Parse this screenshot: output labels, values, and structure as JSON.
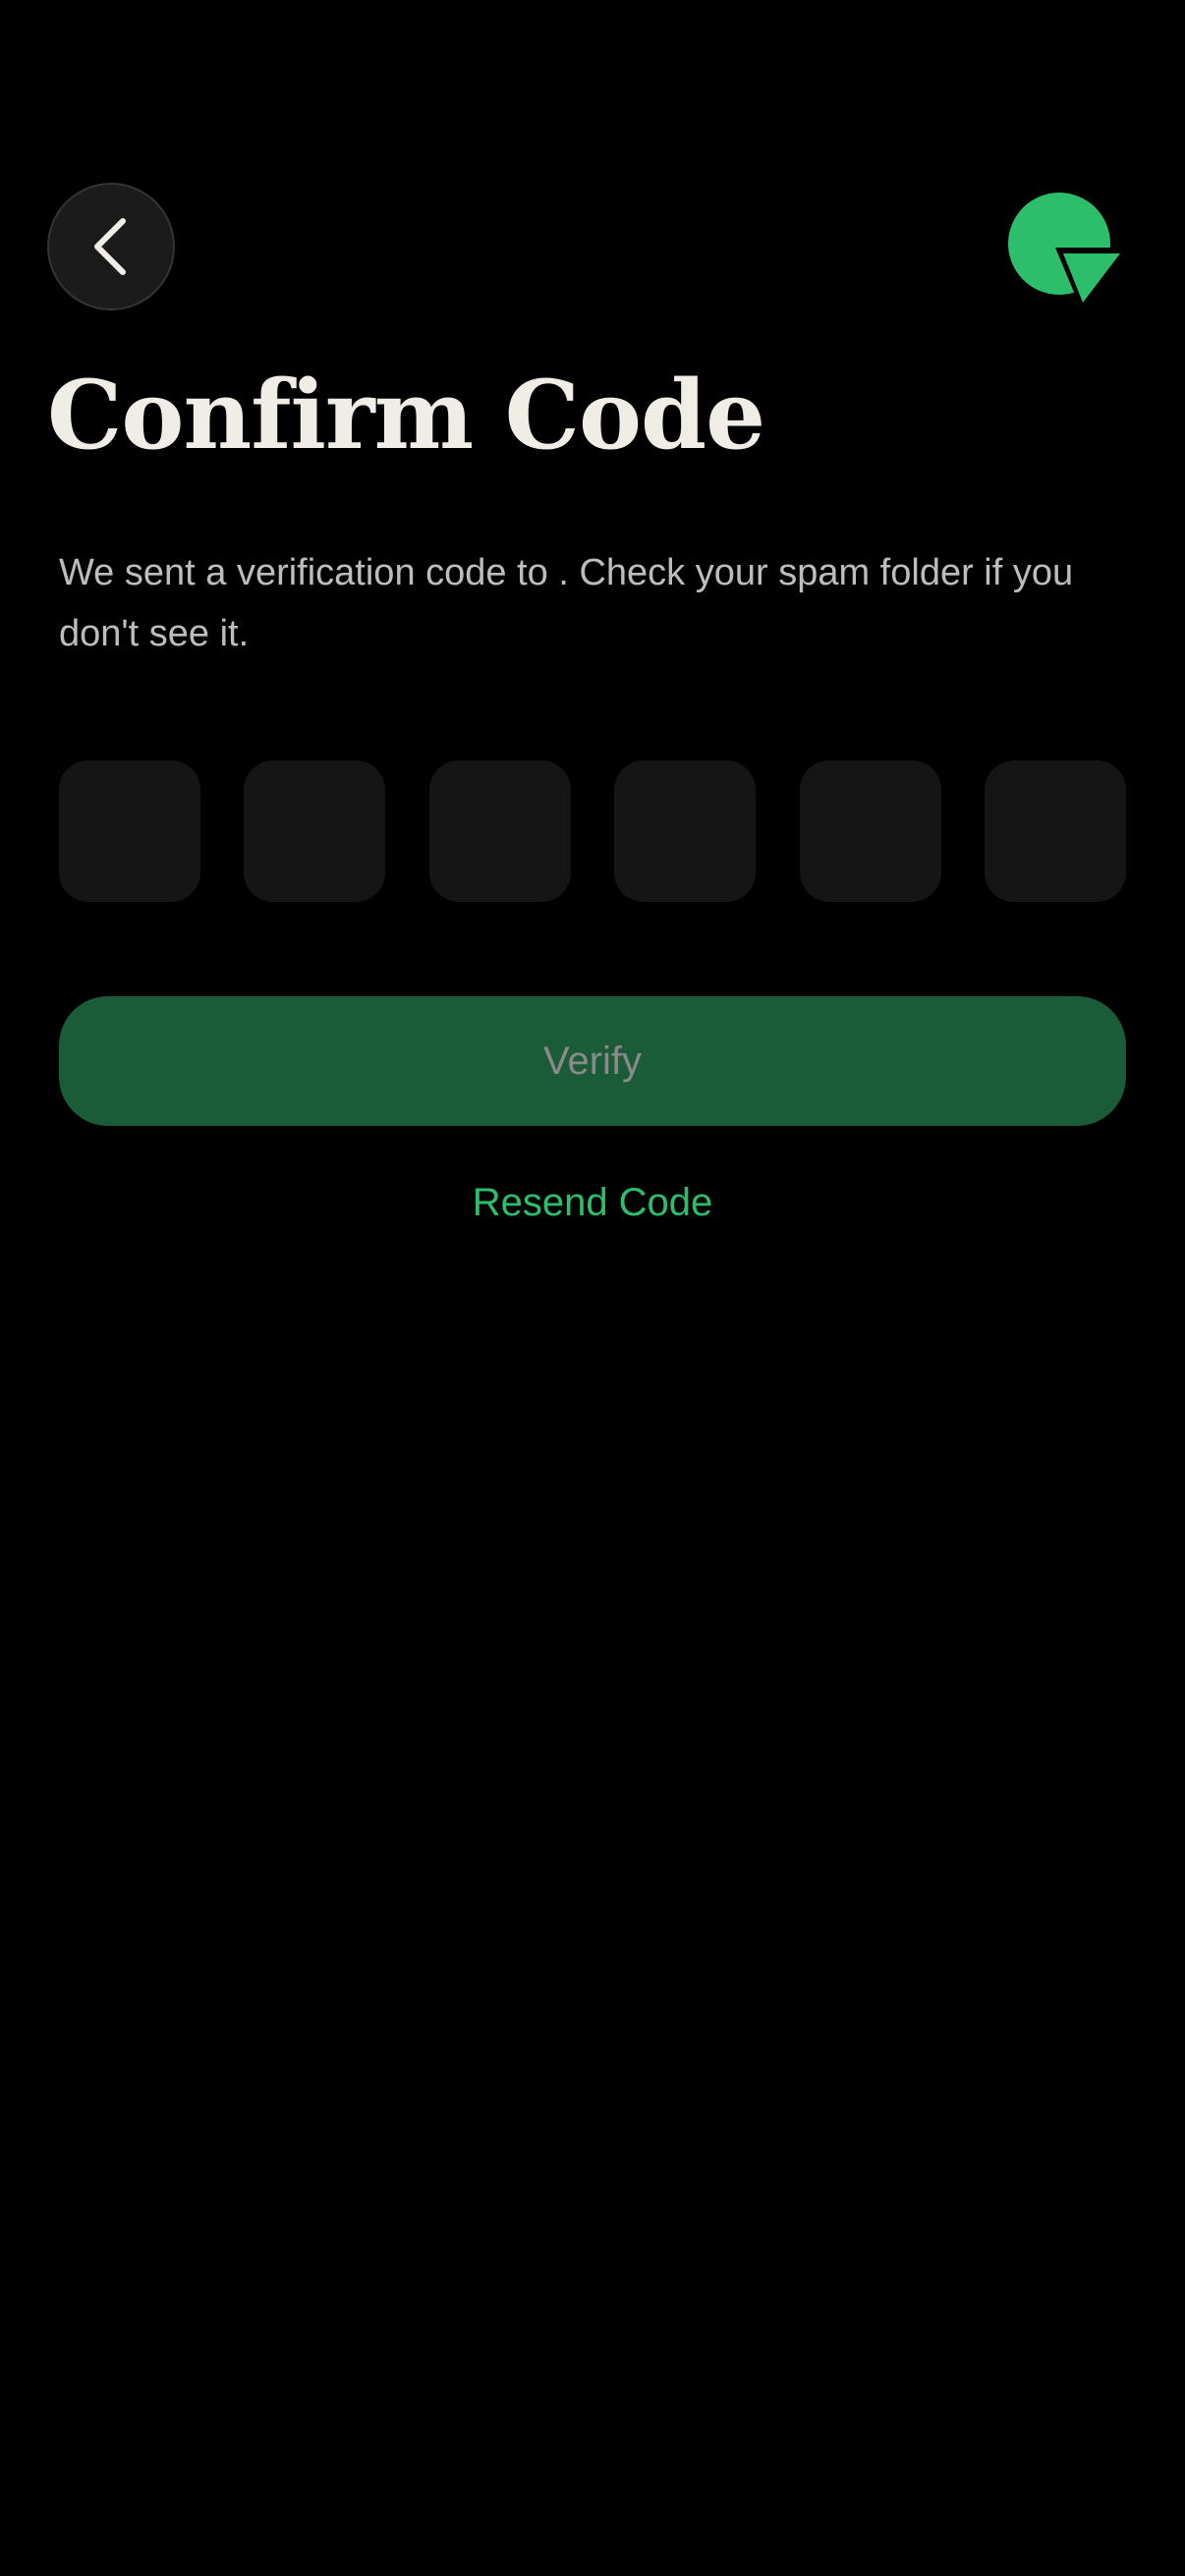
{
  "header": {
    "back_icon": "chevron-left-icon",
    "logo_icon": "brand-logo-icon"
  },
  "main": {
    "title": "Confirm Code",
    "description": "We sent a verification code to . Check your spam folder if you don't see it.",
    "code_inputs": [
      {
        "value": ""
      },
      {
        "value": ""
      },
      {
        "value": ""
      },
      {
        "value": ""
      },
      {
        "value": ""
      },
      {
        "value": ""
      }
    ],
    "verify_label": "Verify",
    "resend_label": "Resend Code"
  },
  "colors": {
    "background": "#000000",
    "accent": "#2dbe6c",
    "verify_button_disabled": "#1b5c38",
    "input_background": "#151515",
    "title_text": "#f0ede6",
    "body_text": "#bdbdbd"
  }
}
